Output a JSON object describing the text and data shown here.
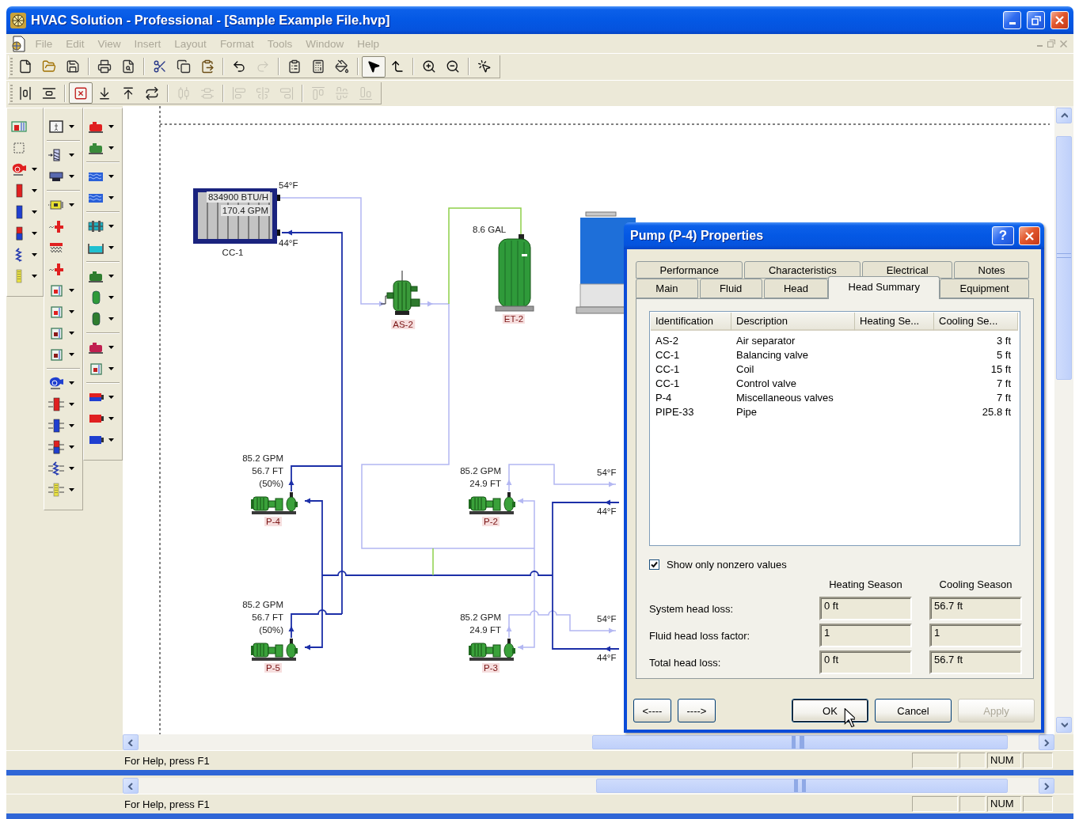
{
  "window": {
    "title": "HVAC Solution - Professional - [Sample Example File.hvp]"
  },
  "menu_bar": {
    "items": [
      {
        "label": "File",
        "disabled": true
      },
      {
        "label": "Edit",
        "disabled": true
      },
      {
        "label": "View",
        "disabled": true
      },
      {
        "label": "Insert",
        "disabled": true
      },
      {
        "label": "Layout",
        "disabled": true
      },
      {
        "label": "Format",
        "disabled": true
      },
      {
        "label": "Tools",
        "disabled": true
      },
      {
        "label": "Window",
        "disabled": true
      },
      {
        "label": "Help",
        "disabled": true
      }
    ],
    "document_controls_disabled": true
  },
  "toolbar_standard": {
    "groups": [
      [
        {
          "disabled": false,
          "pressed": false
        },
        {
          "disabled": false,
          "pressed": false
        },
        {
          "disabled": false,
          "pressed": false
        }
      ],
      [
        {
          "disabled": false,
          "pressed": false
        },
        {
          "disabled": false,
          "pressed": false
        }
      ],
      [
        {
          "disabled": false,
          "pressed": false
        },
        {
          "disabled": false,
          "pressed": false
        },
        {
          "disabled": false,
          "pressed": false
        }
      ],
      [
        {
          "disabled": false,
          "pressed": false
        },
        {
          "disabled": true,
          "pressed": false
        }
      ],
      [
        {
          "disabled": false,
          "pressed": false
        },
        {
          "disabled": false,
          "pressed": false
        },
        {
          "disabled": false,
          "pressed": false
        }
      ],
      [
        {
          "disabled": false,
          "pressed": true
        },
        {
          "disabled": false,
          "pressed": false
        }
      ],
      [
        {
          "disabled": false,
          "pressed": false
        },
        {
          "disabled": false,
          "pressed": false
        }
      ],
      [
        {
          "disabled": false,
          "pressed": false
        }
      ]
    ]
  },
  "toolbar_layout": {
    "groups": [
      [
        {
          "disabled": false,
          "pressed": false
        },
        {
          "disabled": false,
          "pressed": false
        }
      ],
      [
        {
          "disabled": false,
          "pressed": true
        },
        {
          "disabled": false,
          "pressed": false
        },
        {
          "disabled": false,
          "pressed": false
        },
        {
          "disabled": false,
          "pressed": false
        }
      ],
      [
        {
          "disabled": true,
          "pressed": false
        },
        {
          "disabled": true,
          "pressed": false
        }
      ],
      [
        {
          "disabled": true,
          "pressed": false
        },
        {
          "disabled": true,
          "pressed": false
        },
        {
          "disabled": true,
          "pressed": false
        }
      ],
      [
        {
          "disabled": true,
          "pressed": false
        },
        {
          "disabled": true,
          "pressed": false
        },
        {
          "disabled": true,
          "pressed": false
        }
      ]
    ]
  },
  "diagram": {
    "coil": {
      "tag": "CC-1",
      "capacity": "834900 BTU/H",
      "flow": "170.4 GPM",
      "supply_temp": "54°F",
      "return_temp": "44°F"
    },
    "air_separator": {
      "tag": "AS-2"
    },
    "expansion_tank": {
      "tag": "ET-2",
      "volume": "8.6 GAL"
    },
    "pumps": [
      {
        "tag": "P-4",
        "flow": "85.2 GPM",
        "head": "56.7 FT",
        "speed": "(50%)"
      },
      {
        "tag": "P-2",
        "flow": "85.2 GPM",
        "head": "24.9 FT"
      },
      {
        "tag": "P-5",
        "flow": "85.2 GPM",
        "head": "56.7 FT",
        "speed": "(50%)"
      },
      {
        "tag": "P-3",
        "flow": "85.2 GPM",
        "head": "24.9 FT"
      }
    ],
    "chiller_connections": [
      {
        "supply_temp": "54°F",
        "return_temp": "44°F"
      },
      {
        "supply_temp": "54°F",
        "return_temp": "44°F"
      }
    ]
  },
  "dialog": {
    "title": "Pump (P-4) Properties",
    "help_button": "?",
    "tab_rows": [
      [
        {
          "label": "Performance",
          "selected": false
        },
        {
          "label": "Characteristics",
          "selected": false
        },
        {
          "label": "Electrical",
          "selected": false
        },
        {
          "label": "Notes",
          "selected": false
        }
      ],
      [
        {
          "label": "Main",
          "selected": false
        },
        {
          "label": "Fluid",
          "selected": false
        },
        {
          "label": "Head",
          "selected": false
        },
        {
          "label": "Head Summary",
          "selected": true
        },
        {
          "label": "Equipment",
          "selected": false
        }
      ]
    ],
    "head_list": {
      "columns": [
        "Identification",
        "Description",
        "Heating Se...",
        "Cooling Se..."
      ],
      "rows": [
        {
          "identification": "AS-2",
          "description": "Air separator",
          "cooling_season": "3 ft"
        },
        {
          "identification": "CC-1",
          "description": "Balancing valve",
          "cooling_season": "5 ft"
        },
        {
          "identification": "CC-1",
          "description": "Coil",
          "cooling_season": "15 ft"
        },
        {
          "identification": "CC-1",
          "description": "Control valve",
          "cooling_season": "7 ft"
        },
        {
          "identification": "P-4",
          "description": "Miscellaneous valves",
          "cooling_season": "7 ft"
        },
        {
          "identification": "PIPE-33",
          "description": "Pipe",
          "cooling_season": "25.8 ft"
        }
      ]
    },
    "nonzero_only": {
      "label": "Show only nonzero values",
      "checked": true
    },
    "season_columns": [
      "Heating Season",
      "Cooling Season"
    ],
    "totals": [
      {
        "label": "System head loss:",
        "heating": "0 ft",
        "cooling": "56.7 ft"
      },
      {
        "label": "Fluid head loss factor:",
        "heating": "1",
        "cooling": "1"
      },
      {
        "label": "Total head loss:",
        "heating": "0 ft",
        "cooling": "56.7 ft"
      }
    ],
    "buttons": [
      {
        "label": "<----",
        "kind": "nav",
        "disabled": false,
        "default": false
      },
      {
        "label": "---->",
        "kind": "nav",
        "disabled": false,
        "default": false
      },
      {
        "label": "OK",
        "kind": "action",
        "disabled": false,
        "default": true
      },
      {
        "label": "Cancel",
        "kind": "action",
        "disabled": false,
        "default": false
      },
      {
        "label": "Apply",
        "kind": "action",
        "disabled": true,
        "default": false
      }
    ]
  },
  "status_bars": [
    {
      "message": "For Help, press F1",
      "indicator": "NUM"
    },
    {
      "message": "For Help, press F1",
      "indicator": "NUM"
    }
  ]
}
